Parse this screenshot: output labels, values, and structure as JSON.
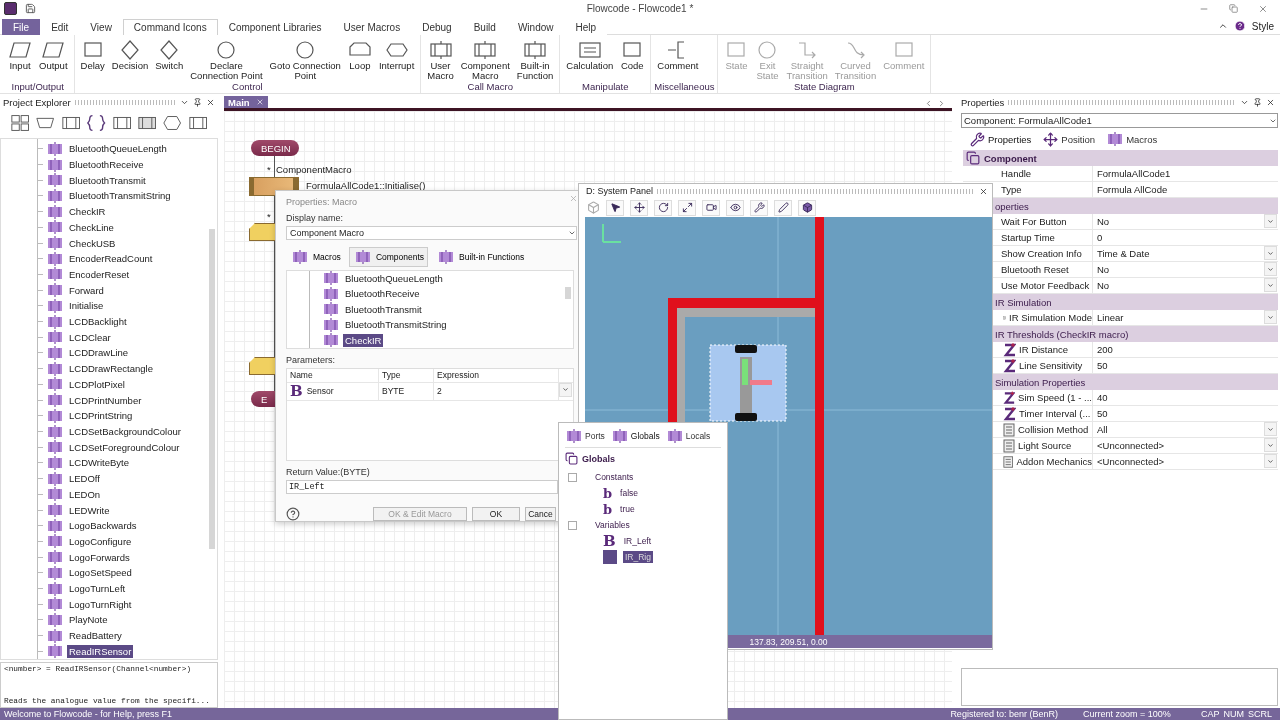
{
  "window": {
    "title": "Flowcode - Flowcode1 *"
  },
  "menu_tabs": [
    {
      "label": "File",
      "kind": "file",
      "selected": false
    },
    {
      "label": "Edit",
      "kind": "tab",
      "selected": false
    },
    {
      "label": "View",
      "kind": "tab",
      "selected": false
    },
    {
      "label": "Command Icons",
      "kind": "tab",
      "selected": true
    },
    {
      "label": "Component Libraries",
      "kind": "tab",
      "selected": false
    },
    {
      "label": "User Macros",
      "kind": "tab",
      "selected": false
    },
    {
      "label": "Debug",
      "kind": "tab",
      "selected": false
    },
    {
      "label": "Build",
      "kind": "tab",
      "selected": false
    },
    {
      "label": "Window",
      "kind": "tab",
      "selected": false
    },
    {
      "label": "Help",
      "kind": "tab",
      "selected": false
    }
  ],
  "style_label": "Style",
  "ribbon_groups": [
    {
      "label": "Input/Output",
      "buttons": [
        {
          "label": "Input",
          "disabled": false
        },
        {
          "label": "Output",
          "disabled": false
        }
      ]
    },
    {
      "label": "Control",
      "buttons": [
        {
          "label": "Delay",
          "disabled": false
        },
        {
          "label": "Decision",
          "disabled": false
        },
        {
          "label": "Switch",
          "disabled": false
        },
        {
          "label": "Declare\nConnection Point",
          "disabled": false
        },
        {
          "label": "Goto Connection\nPoint",
          "disabled": false
        },
        {
          "label": "Loop",
          "disabled": false
        },
        {
          "label": "Interrupt",
          "disabled": false
        }
      ]
    },
    {
      "label": "Call Macro",
      "buttons": [
        {
          "label": "User\nMacro",
          "disabled": false
        },
        {
          "label": "Component\nMacro",
          "disabled": false
        },
        {
          "label": "Built-in\nFunction",
          "disabled": false
        }
      ]
    },
    {
      "label": "Manipulate",
      "buttons": [
        {
          "label": "Calculation",
          "disabled": false
        },
        {
          "label": "Code",
          "disabled": false
        }
      ]
    },
    {
      "label": "Miscellaneous",
      "buttons": [
        {
          "label": "Comment",
          "disabled": false
        }
      ]
    },
    {
      "label": "State Diagram",
      "buttons": [
        {
          "label": "State",
          "disabled": true
        },
        {
          "label": "Exit\nState",
          "disabled": true
        },
        {
          "label": "Straight\nTransition",
          "disabled": true
        },
        {
          "label": "Curved\nTransition",
          "disabled": true
        },
        {
          "label": "Comment",
          "disabled": true
        }
      ]
    }
  ],
  "project_explorer": {
    "title": "Project Explorer",
    "items": [
      {
        "label": "BluetoothQueueLength",
        "selected": false
      },
      {
        "label": "BluetoothReceive",
        "selected": false
      },
      {
        "label": "BluetoothTransmit",
        "selected": false
      },
      {
        "label": "BluetoothTransmitString",
        "selected": false
      },
      {
        "label": "CheckIR",
        "selected": false
      },
      {
        "label": "CheckLine",
        "selected": false
      },
      {
        "label": "CheckUSB",
        "selected": false
      },
      {
        "label": "EncoderReadCount",
        "selected": false
      },
      {
        "label": "EncoderReset",
        "selected": false
      },
      {
        "label": "Forward",
        "selected": false
      },
      {
        "label": "Initialise",
        "selected": false
      },
      {
        "label": "LCDBacklight",
        "selected": false
      },
      {
        "label": "LCDClear",
        "selected": false
      },
      {
        "label": "LCDDrawLine",
        "selected": false
      },
      {
        "label": "LCDDrawRectangle",
        "selected": false
      },
      {
        "label": "LCDPlotPixel",
        "selected": false
      },
      {
        "label": "LCDPrintNumber",
        "selected": false
      },
      {
        "label": "LCDPrintString",
        "selected": false
      },
      {
        "label": "LCDSetBackgroundColour",
        "selected": false
      },
      {
        "label": "LCDSetForegroundColour",
        "selected": false
      },
      {
        "label": "LCDWriteByte",
        "selected": false
      },
      {
        "label": "LEDOff",
        "selected": false
      },
      {
        "label": "LEDOn",
        "selected": false
      },
      {
        "label": "LEDWrite",
        "selected": false
      },
      {
        "label": "LogoBackwards",
        "selected": false
      },
      {
        "label": "LogoConfigure",
        "selected": false
      },
      {
        "label": "LogoForwards",
        "selected": false
      },
      {
        "label": "LogoSetSpeed",
        "selected": false
      },
      {
        "label": "LogoTurnLeft",
        "selected": false
      },
      {
        "label": "LogoTurnRight",
        "selected": false
      },
      {
        "label": "PlayNote",
        "selected": false
      },
      {
        "label": "ReadBattery",
        "selected": false
      },
      {
        "label": "ReadIRSensor",
        "selected": true
      }
    ],
    "signature": "<number> = ReadIRSensor(Channel<number>)",
    "description": "Reads the analogue value from the specifi..."
  },
  "document_tabs": [
    {
      "label": "Main",
      "selected": true
    }
  ],
  "flowchart": [
    {
      "kind": "begin",
      "label": "BEGIN"
    },
    {
      "kind": "macro",
      "marker": "*",
      "title": "ComponentMacro",
      "call": "FormulaAllCode1::Initialise()"
    },
    {
      "kind": "step",
      "marker": "*"
    },
    {
      "kind": "step"
    },
    {
      "kind": "end",
      "label": "E"
    }
  ],
  "macro_dialog": {
    "title": "Properties: Macro",
    "display_name_label": "Display name:",
    "display_name": "Component Macro",
    "tabs": [
      {
        "label": "Macros",
        "selected": false
      },
      {
        "label": "Components",
        "selected": true
      },
      {
        "label": "Built-in Functions",
        "selected": false
      }
    ],
    "items": [
      {
        "label": "BluetoothQueueLength",
        "selected": false
      },
      {
        "label": "BluetoothReceive",
        "selected": false
      },
      {
        "label": "BluetoothTransmit",
        "selected": false
      },
      {
        "label": "BluetoothTransmitString",
        "selected": false
      },
      {
        "label": "CheckIR",
        "selected": true
      }
    ],
    "parameters_label": "Parameters:",
    "columns": [
      "Name",
      "Type",
      "Expression"
    ],
    "parameters": [
      {
        "glyph": "B",
        "name": "Sensor",
        "type": "BYTE",
        "expression": "2"
      }
    ],
    "return_label": "Return Value:(BYTE)",
    "return_value": "IR_Left",
    "buttons": [
      {
        "label": "OK & Edit Macro",
        "disabled": true
      },
      {
        "label": "OK",
        "disabled": false
      },
      {
        "label": "Cance",
        "disabled": false
      }
    ]
  },
  "system_panel": {
    "title": "D: System Panel",
    "coordinates": "137.83, 209.51, 0.00"
  },
  "globals_panel": {
    "tabs": [
      {
        "label": "Ports",
        "selected": false
      },
      {
        "label": "Globals",
        "selected": true
      },
      {
        "label": "Locals",
        "selected": false
      }
    ],
    "root": "Globals",
    "groups": [
      {
        "label": "Constants",
        "expanded": true,
        "children": [
          {
            "glyph": "b",
            "label": "false",
            "selected": false
          },
          {
            "glyph": "b",
            "label": "true",
            "selected": false
          }
        ]
      },
      {
        "label": "Variables",
        "expanded": true,
        "children": [
          {
            "glyph": "B",
            "label": "IR_Left",
            "selected": false
          },
          {
            "label": "IR_Rig",
            "selected": true
          }
        ]
      }
    ]
  },
  "properties": {
    "title": "Properties",
    "selector": "Component: FormulaAllCode1",
    "tabs": [
      {
        "label": "Properties",
        "selected": true
      },
      {
        "label": "Position",
        "selected": false
      },
      {
        "label": "Macros",
        "selected": false
      }
    ],
    "sections": [
      {
        "title": "Component",
        "kind": "main",
        "rows": [
          {
            "kind": "plain",
            "label": "Handle",
            "value": "FormulaAllCode1",
            "dropdown": false
          },
          {
            "kind": "plain",
            "label": "Type",
            "value": "Formula AllCode",
            "dropdown": false
          }
        ]
      },
      {
        "title": "operties",
        "kind": "sub",
        "rows": [
          {
            "kind": "plain",
            "label": "Wait For Button",
            "value": "No",
            "dropdown": true
          },
          {
            "kind": "plain",
            "label": "Startup Time",
            "value": "0",
            "dropdown": false
          },
          {
            "kind": "plain",
            "label": "Show Creation Info",
            "value": "Time & Date",
            "dropdown": true
          },
          {
            "kind": "plain",
            "label": "Bluetooth Reset",
            "value": "No",
            "dropdown": true
          },
          {
            "kind": "plain",
            "label": "Use Motor Feedback",
            "value": "No",
            "dropdown": true
          }
        ]
      },
      {
        "title": "IR Simulation",
        "kind": "sub",
        "rows": [
          {
            "kind": "list",
            "label": "IR Simulation Mode",
            "value": "Linear",
            "dropdown": true
          }
        ]
      },
      {
        "title": "IR Thresholds (CheckIR macro)",
        "kind": "sub",
        "rows": [
          {
            "kind": "number",
            "label": "IR Distance",
            "value": "200",
            "dropdown": false
          },
          {
            "kind": "number",
            "label": "Line Sensitivity",
            "value": "50",
            "dropdown": false
          }
        ]
      },
      {
        "title": "Simulation Properties",
        "kind": "sub",
        "rows": [
          {
            "kind": "number",
            "label": "Sim Speed (1 - ...",
            "value": "40",
            "dropdown": false
          },
          {
            "kind": "number",
            "label": "Timer Interval (...",
            "value": "50",
            "dropdown": false
          },
          {
            "kind": "list",
            "label": "Collision Method",
            "value": "All",
            "dropdown": true
          },
          {
            "kind": "list",
            "label": "Light Source",
            "value": "<Unconnected>",
            "dropdown": true
          },
          {
            "kind": "list",
            "label": "Addon Mechanics",
            "value": "<Unconnected>",
            "dropdown": true
          }
        ]
      }
    ]
  },
  "status_bar": {
    "message": "Welcome to Flowcode - for Help, press F1",
    "registered": "Registered to: benr (BenR)",
    "zoom": "Current zoom = 100%",
    "indicators": [
      "CAP",
      "NUM",
      "SCRL"
    ]
  }
}
